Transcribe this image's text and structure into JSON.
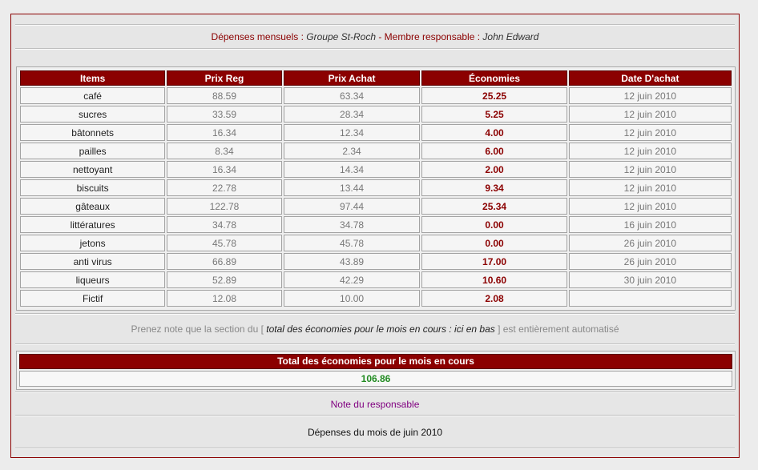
{
  "header": {
    "label_depenses": "Dépenses mensuels :",
    "group": "Groupe St-Roch",
    "sep": " - ",
    "label_membre": "Membre responsable :",
    "member": "John Edward"
  },
  "table": {
    "columns": [
      "Items",
      "Prix Reg",
      "Prix Achat",
      "Économies",
      "Date D'achat"
    ],
    "rows": [
      {
        "item": "café",
        "reg": "88.59",
        "achat": "63.34",
        "eco": "25.25",
        "date": "12 juin 2010"
      },
      {
        "item": "sucres",
        "reg": "33.59",
        "achat": "28.34",
        "eco": "5.25",
        "date": "12 juin 2010"
      },
      {
        "item": "bâtonnets",
        "reg": "16.34",
        "achat": "12.34",
        "eco": "4.00",
        "date": "12 juin 2010"
      },
      {
        "item": "pailles",
        "reg": "8.34",
        "achat": "2.34",
        "eco": "6.00",
        "date": "12 juin 2010"
      },
      {
        "item": "nettoyant",
        "reg": "16.34",
        "achat": "14.34",
        "eco": "2.00",
        "date": "12 juin 2010"
      },
      {
        "item": "biscuits",
        "reg": "22.78",
        "achat": "13.44",
        "eco": "9.34",
        "date": "12 juin 2010"
      },
      {
        "item": "gâteaux",
        "reg": "122.78",
        "achat": "97.44",
        "eco": "25.34",
        "date": "12 juin 2010"
      },
      {
        "item": "littératures",
        "reg": "34.78",
        "achat": "34.78",
        "eco": "0.00",
        "date": "16 juin 2010"
      },
      {
        "item": "jetons",
        "reg": "45.78",
        "achat": "45.78",
        "eco": "0.00",
        "date": "26 juin 2010"
      },
      {
        "item": "anti virus",
        "reg": "66.89",
        "achat": "43.89",
        "eco": "17.00",
        "date": "26 juin 2010"
      },
      {
        "item": "liqueurs",
        "reg": "52.89",
        "achat": "42.29",
        "eco": "10.60",
        "date": "30 juin 2010"
      },
      {
        "item": "Fictif",
        "reg": "12.08",
        "achat": "10.00",
        "eco": "2.08",
        "date": ""
      }
    ]
  },
  "note": {
    "prefix": "Prenez note que la section du [",
    "emph": "total des économies pour le mois en cours : ici en bas",
    "suffix": "] est entièrement automatisé"
  },
  "total": {
    "title": "Total des économies pour le mois en cours",
    "value": "106.86"
  },
  "responsable_link": "Note du responsable",
  "month_title": "Dépenses du mois de juin 2010"
}
